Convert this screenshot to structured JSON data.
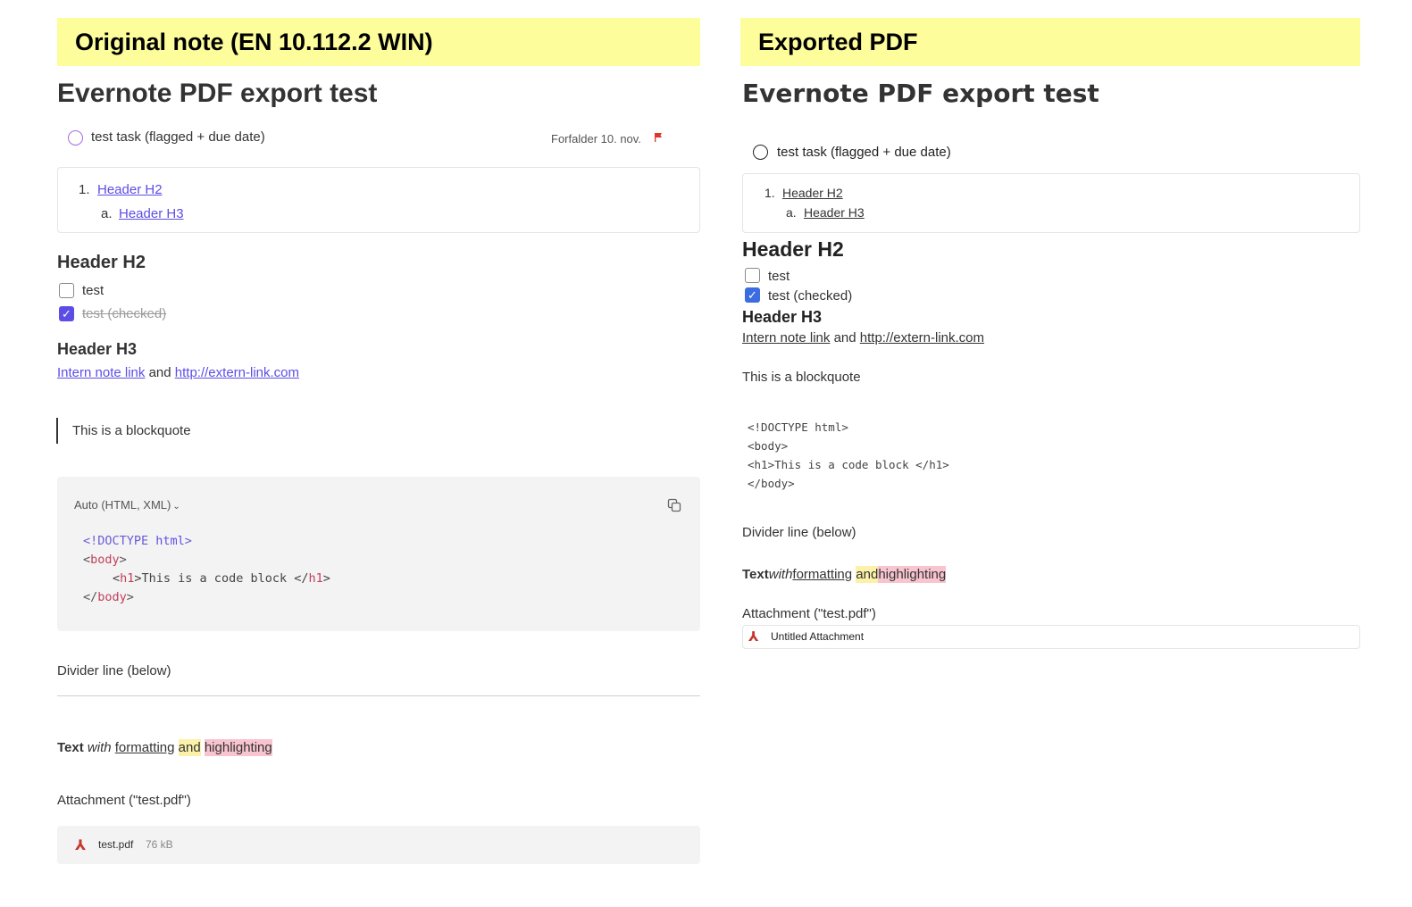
{
  "left": {
    "banner": "Original note (EN 10.112.2 WIN)",
    "title": "Evernote PDF export test",
    "task": {
      "label": "test task (flagged + due date)",
      "due": "Forfalder 10. nov."
    },
    "toc": {
      "item1_num": "1.",
      "item1": "Header H2",
      "item2_num": "a.",
      "item2": "Header H3"
    },
    "h2": "Header H2",
    "checklist": [
      {
        "label": "test",
        "checked": false
      },
      {
        "label": "test (checked)",
        "checked": true
      }
    ],
    "h3": "Header H3",
    "links": {
      "internal": "Intern note link",
      "and": "and",
      "external": "http://extern-link.com"
    },
    "blockquote": "This is a blockquote",
    "code": {
      "language": "Auto (HTML, XML)",
      "line1_open": "<!DOCTYPE ",
      "line1_kw": "html",
      "line1_close": ">",
      "line2_open": "<",
      "line2_tag": "body",
      "line2_close": ">",
      "line3_open": "<",
      "line3_tag": "h1",
      "line3_text": ">This is a code block </",
      "line3_tag2": "h1",
      "line3_close": ">",
      "line4_open": "</",
      "line4_tag": "body",
      "line4_close": ">"
    },
    "divider_label": "Divider line (below)",
    "formatting": {
      "bold": "Text",
      "italic": "with",
      "underline": "formatting",
      "yellow": "and",
      "pink": "highlighting"
    },
    "attachment_label": "Attachment (\"test.pdf\")",
    "attachment": {
      "name": "test.pdf",
      "size": "76 kB"
    }
  },
  "right": {
    "banner": "Exported PDF",
    "title": "Evernote PDF export test",
    "task": "test task (flagged + due date)",
    "toc": {
      "item1_num": "1.",
      "item1": "Header H2",
      "item2_num": "a.",
      "item2": "Header H3"
    },
    "h2": "Header H2",
    "checklist": [
      {
        "label": "test",
        "checked": false
      },
      {
        "label": "test (checked)",
        "checked": true
      }
    ],
    "h3": "Header H3",
    "links": {
      "internal": "Intern note link",
      "and": "and",
      "external": "http://extern-link.com"
    },
    "blockquote": "This is a blockquote",
    "code": {
      "line1": "<!DOCTYPE html>",
      "line2": "<body>",
      "line3": "<h1>This is a code block </h1>",
      "line4": "</body>"
    },
    "divider_label": "Divider line (below)",
    "formatting": {
      "bold": "Text",
      "italic": "with",
      "underline": "formatting",
      "yellow": "and",
      "pink": "highlighting"
    },
    "attachment_label": "Attachment (\"test.pdf\")",
    "attachment": {
      "name": "Untitled Attachment"
    }
  },
  "colors": {
    "banner": "#fdfd9c",
    "accent": "#5c4ee5",
    "link": "#5c4ee5",
    "flag": "#e0342b",
    "highlight_yellow": "#fbf1a9",
    "highlight_pink": "#f8c4cf",
    "pdf_icon": "#c8372d"
  }
}
